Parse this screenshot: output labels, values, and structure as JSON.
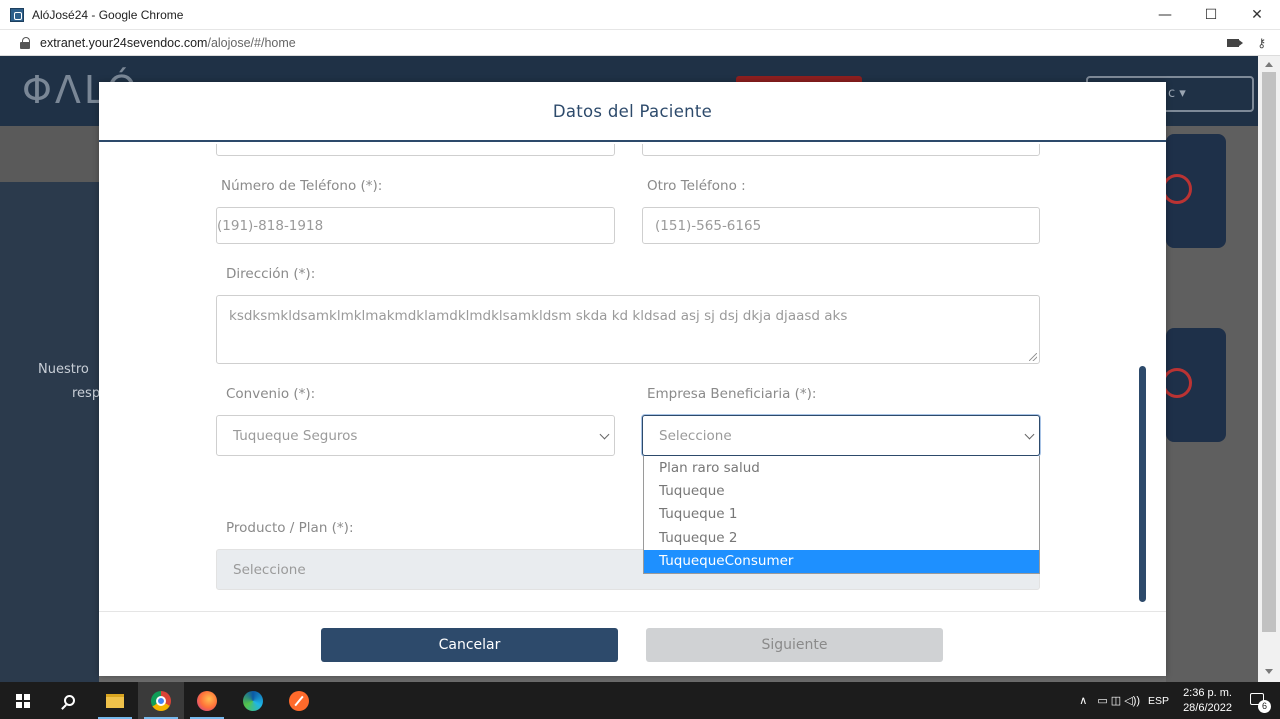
{
  "window": {
    "title": "AlóJosé24 - Google Chrome",
    "controls": {
      "minimize": "—",
      "maximize": "☐",
      "close": "✕"
    }
  },
  "address_bar": {
    "host": "extranet.your24sevendoc.com",
    "path": "/alojose/#/home"
  },
  "background_page": {
    "logo_text": "ΦΛLÓ",
    "user_menu_text": "c ▾",
    "side_text_1": "Nuestro",
    "side_text_2": "resp"
  },
  "modal": {
    "title": "Datos del Paciente",
    "fields": {
      "phone": {
        "label": "Número de Teléfono (*):",
        "value": "(191)-818-1918"
      },
      "other_phone": {
        "label": "Otro Teléfono :",
        "value": "(151)-565-6165"
      },
      "address": {
        "label": "Dirección (*):",
        "value": "ksdksmkldsamklmklmakmdklamdklmdklsamkldsm  skda kd kldsad asj sj dsj dkja djaasd aks"
      },
      "agreement": {
        "label": "Convenio (*):",
        "value": "Tuqueque Seguros"
      },
      "beneficiary_company": {
        "label": "Empresa Beneficiaria (*):",
        "value": "Seleccione",
        "options": [
          "Plan raro salud",
          "Tuqueque",
          "Tuqueque 1",
          "Tuqueque 2",
          "TuquequeConsumer"
        ],
        "highlighted_index": 4
      },
      "product_plan": {
        "label": "Producto / Plan (*):",
        "value": "Seleccione"
      }
    },
    "buttons": {
      "cancel": "Cancelar",
      "next": "Siguiente"
    }
  },
  "taskbar": {
    "language": "ESP",
    "time": "2:36 p. m.",
    "date": "28/6/2022",
    "notification_count": "6",
    "tray_chevron": "∧",
    "tray_icons": "▭ ◫ ◁))"
  },
  "colors": {
    "primary": "#2d4a6b",
    "highlight": "#1e90ff",
    "disabled_button": "#d0d2d4"
  }
}
